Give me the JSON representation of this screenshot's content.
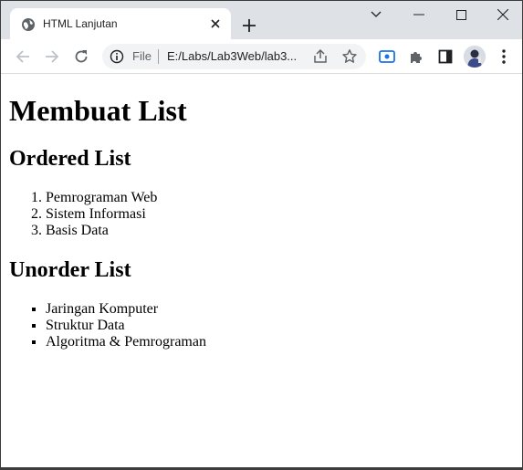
{
  "browser": {
    "tab_title": "HTML Lanjutan",
    "omnibox_scheme": "File",
    "omnibox_url": "E:/Labs/Lab3Web/lab3..."
  },
  "page": {
    "heading": "Membuat List",
    "ordered": {
      "title": "Ordered List",
      "items": [
        "Pemrograman Web",
        "Sistem Informasi",
        "Basis Data"
      ]
    },
    "unordered": {
      "title": "Unorder List",
      "items": [
        "Jaringan Komputer",
        "Struktur Data",
        "Algoritma & Pemrograman"
      ]
    }
  },
  "colors": {
    "tabstrip": "#dee1e6",
    "accent": "#1a73e8",
    "icon": "#5f6368"
  }
}
